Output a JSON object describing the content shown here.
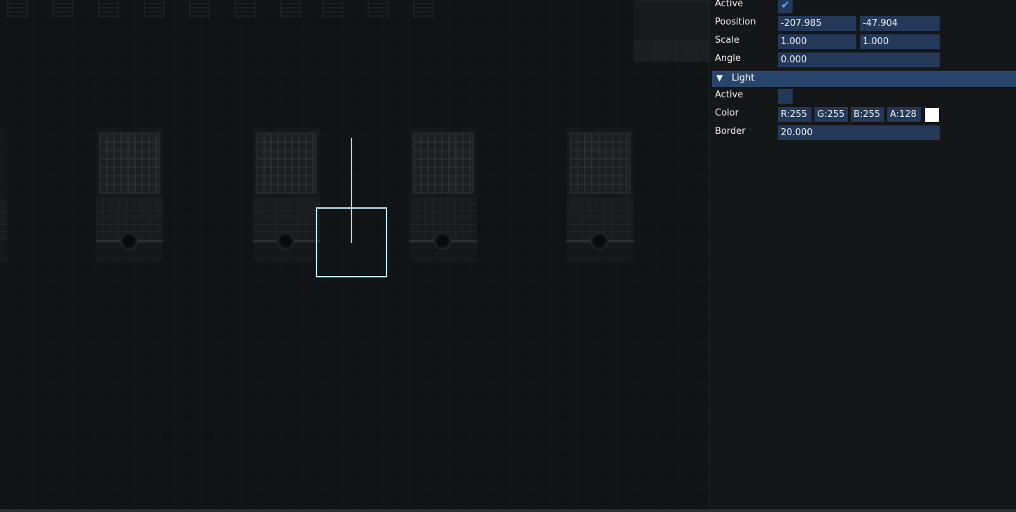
{
  "inspector": {
    "transform": {
      "active_label": "Active",
      "active_checked": true,
      "position_label": "Poosition",
      "position_x": "-207.985",
      "position_y": "-47.904",
      "scale_label": "Scale",
      "scale_x": "1.000",
      "scale_y": "1.000",
      "angle_label": "Angle",
      "angle_value": "0.000"
    },
    "light": {
      "header_label": "Light",
      "header_arrow": "▼",
      "active_label": "Active",
      "active_checked": false,
      "color_label": "Color",
      "color_r": "R:255",
      "color_g": "G:255",
      "color_b": "B:255",
      "color_a": "A:128",
      "color_swatch": "#ffffff",
      "border_label": "Border",
      "border_value": "20.000"
    },
    "checkmark_glyph": "✔"
  },
  "theme": {
    "field_bg": "#24395a",
    "header_bg": "#29456b",
    "gizmo": "#bfe9f7",
    "checkmark": "#5aa0ff"
  }
}
